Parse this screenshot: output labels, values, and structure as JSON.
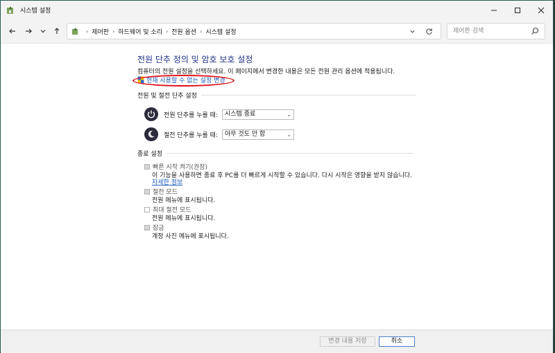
{
  "window": {
    "title": "시스템 설정"
  },
  "address": {
    "crumbs": [
      "제어판",
      "하드웨어 및 소리",
      "전원 옵션",
      "시스템 설정"
    ],
    "search_placeholder": "제어판 검색"
  },
  "page": {
    "title": "전원 단추 정의 및 암호 보호 설정",
    "description": "컴퓨터의 전원 설정을 선택하세요. 이 페이지에서 변경한 내용은 모든 전원 관리 옵션에 적용됩니다.",
    "change_link": "현재 사용할 수 없는 설정 변경"
  },
  "power_section": {
    "header": "전원 및 절전 단추 설정",
    "rows": [
      {
        "label": "전원 단추를 누를 때:",
        "value": "시스템 종료"
      },
      {
        "label": "절전 단추를 누를 때:",
        "value": "아무 것도 안 함"
      }
    ]
  },
  "shutdown_section": {
    "header": "종료 설정",
    "items": [
      {
        "label": "빠른 시작 켜기(권장)",
        "checked": true,
        "desc": "이 기능을 사용하면 종료 후 PC를 더 빠르게 시작할 수 있습니다. 다시 시작은 영향을 받지 않습니다.",
        "link": "자세한 정보"
      },
      {
        "label": "절전 모드",
        "checked": true,
        "desc": "전원 메뉴에 표시됩니다."
      },
      {
        "label": "최대 절전 모드",
        "checked": false,
        "desc": "전원 메뉴에 표시됩니다."
      },
      {
        "label": "잠금",
        "checked": true,
        "desc": "계정 사진 메뉴에 표시됩니다."
      }
    ]
  },
  "footer": {
    "save_label": "변경 내용 저장",
    "cancel_label": "취소"
  },
  "colors": {
    "title": "#1e3287",
    "link": "#1a5dbb",
    "highlight": "#e0131a"
  }
}
